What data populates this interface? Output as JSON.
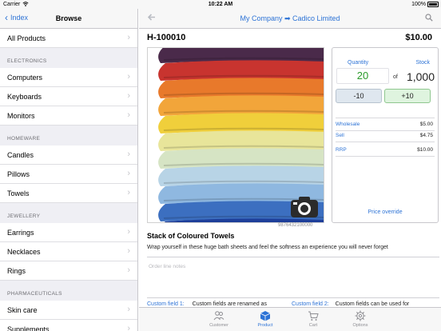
{
  "status": {
    "carrier": "Carrier",
    "time": "10:22 AM",
    "battery": "100%"
  },
  "left": {
    "back_label": "Index",
    "title": "Browse",
    "top_items": [
      {
        "label": "All Products"
      }
    ],
    "sections": [
      {
        "header": "ELECTRONICS",
        "items": [
          {
            "label": "Computers"
          },
          {
            "label": "Keyboards"
          },
          {
            "label": "Monitors"
          }
        ]
      },
      {
        "header": "HOMEWARE",
        "items": [
          {
            "label": "Candles"
          },
          {
            "label": "Pillows"
          },
          {
            "label": "Towels"
          }
        ]
      },
      {
        "header": "JEWELLERY",
        "items": [
          {
            "label": "Earrings"
          },
          {
            "label": "Necklaces"
          },
          {
            "label": "Rings"
          }
        ]
      },
      {
        "header": "PHARMACEUTICALS",
        "items": [
          {
            "label": "Skin care"
          },
          {
            "label": "Supplements"
          }
        ]
      }
    ]
  },
  "right": {
    "breadcrumb": "My Company ➡ Cadico Limited",
    "sku": "H-100010",
    "price": "$10.00",
    "barcode": "9876432100000",
    "product_name": "Stack of Coloured Towels",
    "description": "Wrap yourself in these huge bath sheets and feel the softness an experience you will never forget",
    "notes_placeholder": "Order line notes",
    "towel_colors": [
      "#4a2a4a",
      "#c8342f",
      "#e8792b",
      "#f2a53a",
      "#f0cf3b",
      "#e8e59a",
      "#d6e4c4",
      "#b8d4e6",
      "#8fb8e0",
      "#3c6fc0",
      "#1e3f9a"
    ],
    "stock": {
      "quantity_label": "Quantity",
      "stock_label": "Stock",
      "quantity": "20",
      "of": "of",
      "stock": "1,000",
      "minus": "-10",
      "plus": "+10",
      "prices": [
        {
          "label": "Wholesale",
          "value": "$5.00"
        },
        {
          "label": "Sell",
          "value": "$4.75"
        },
        {
          "label": "RRP",
          "value": "$10.00"
        }
      ],
      "override": "Price override"
    },
    "custom_fields": [
      {
        "label": "Custom field 1:",
        "value": "Custom fields are renamed as"
      },
      {
        "label": "Custom field 2:",
        "value": "Custom fields can be used for"
      }
    ],
    "tabs": [
      {
        "label": "Customer",
        "icon": "customer-icon",
        "active": false
      },
      {
        "label": "Product",
        "icon": "product-icon",
        "active": true
      },
      {
        "label": "Cart",
        "icon": "cart-icon",
        "active": false
      },
      {
        "label": "Options",
        "icon": "gear-icon",
        "active": false
      }
    ]
  }
}
